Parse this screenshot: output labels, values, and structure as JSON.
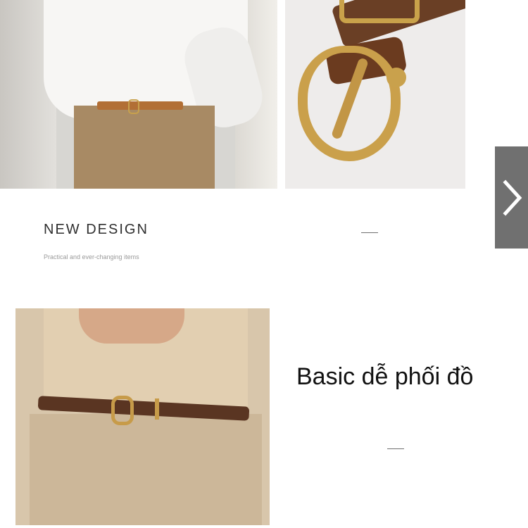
{
  "left_text": {
    "title": "NEW DESIGN",
    "subtitle": "Practical and ever-changing items"
  },
  "right_caption": "Basic dễ phối đồ",
  "navigation": {
    "next_icon": "chevron-right-icon"
  },
  "colors": {
    "nav_button_bg": "#707070",
    "belt_brown": "#5a3522",
    "buckle_gold": "#c9a24a"
  }
}
